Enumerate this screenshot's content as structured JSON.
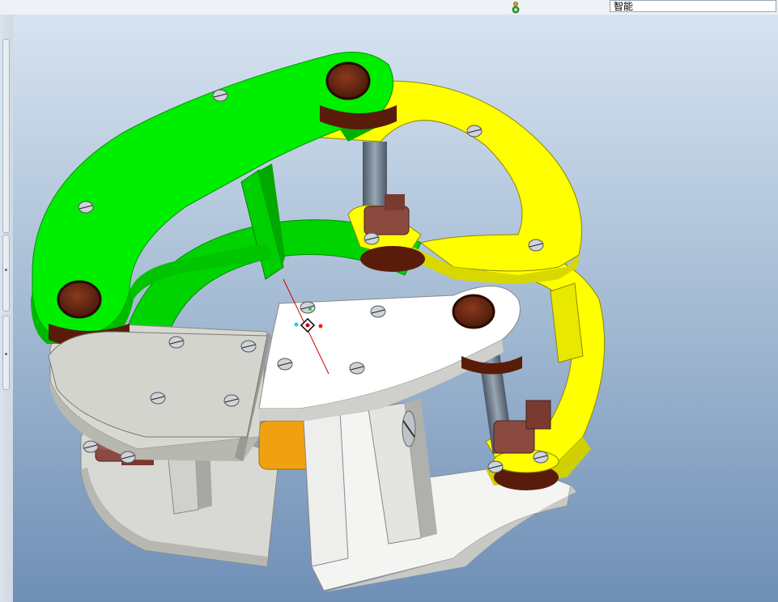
{
  "toolbar": {
    "status_icon": "mapkey-figure-icon",
    "filter_value": "智能"
  },
  "viewport": {
    "background_top": "#d7e3f0",
    "background_bottom": "#6f8fb6",
    "model_colors": {
      "green_arm": "#00ee00",
      "yellow_arm": "#ffff00",
      "base_plates": "#d8d8d4",
      "front_plate": "#ffffff",
      "bushing": "#6b2a14",
      "shaft": "#7a8696",
      "spacer": "#f0a010"
    },
    "icons": [
      "model-origin-icon",
      "screw-hole-icon",
      "pin-joint-icon"
    ]
  }
}
